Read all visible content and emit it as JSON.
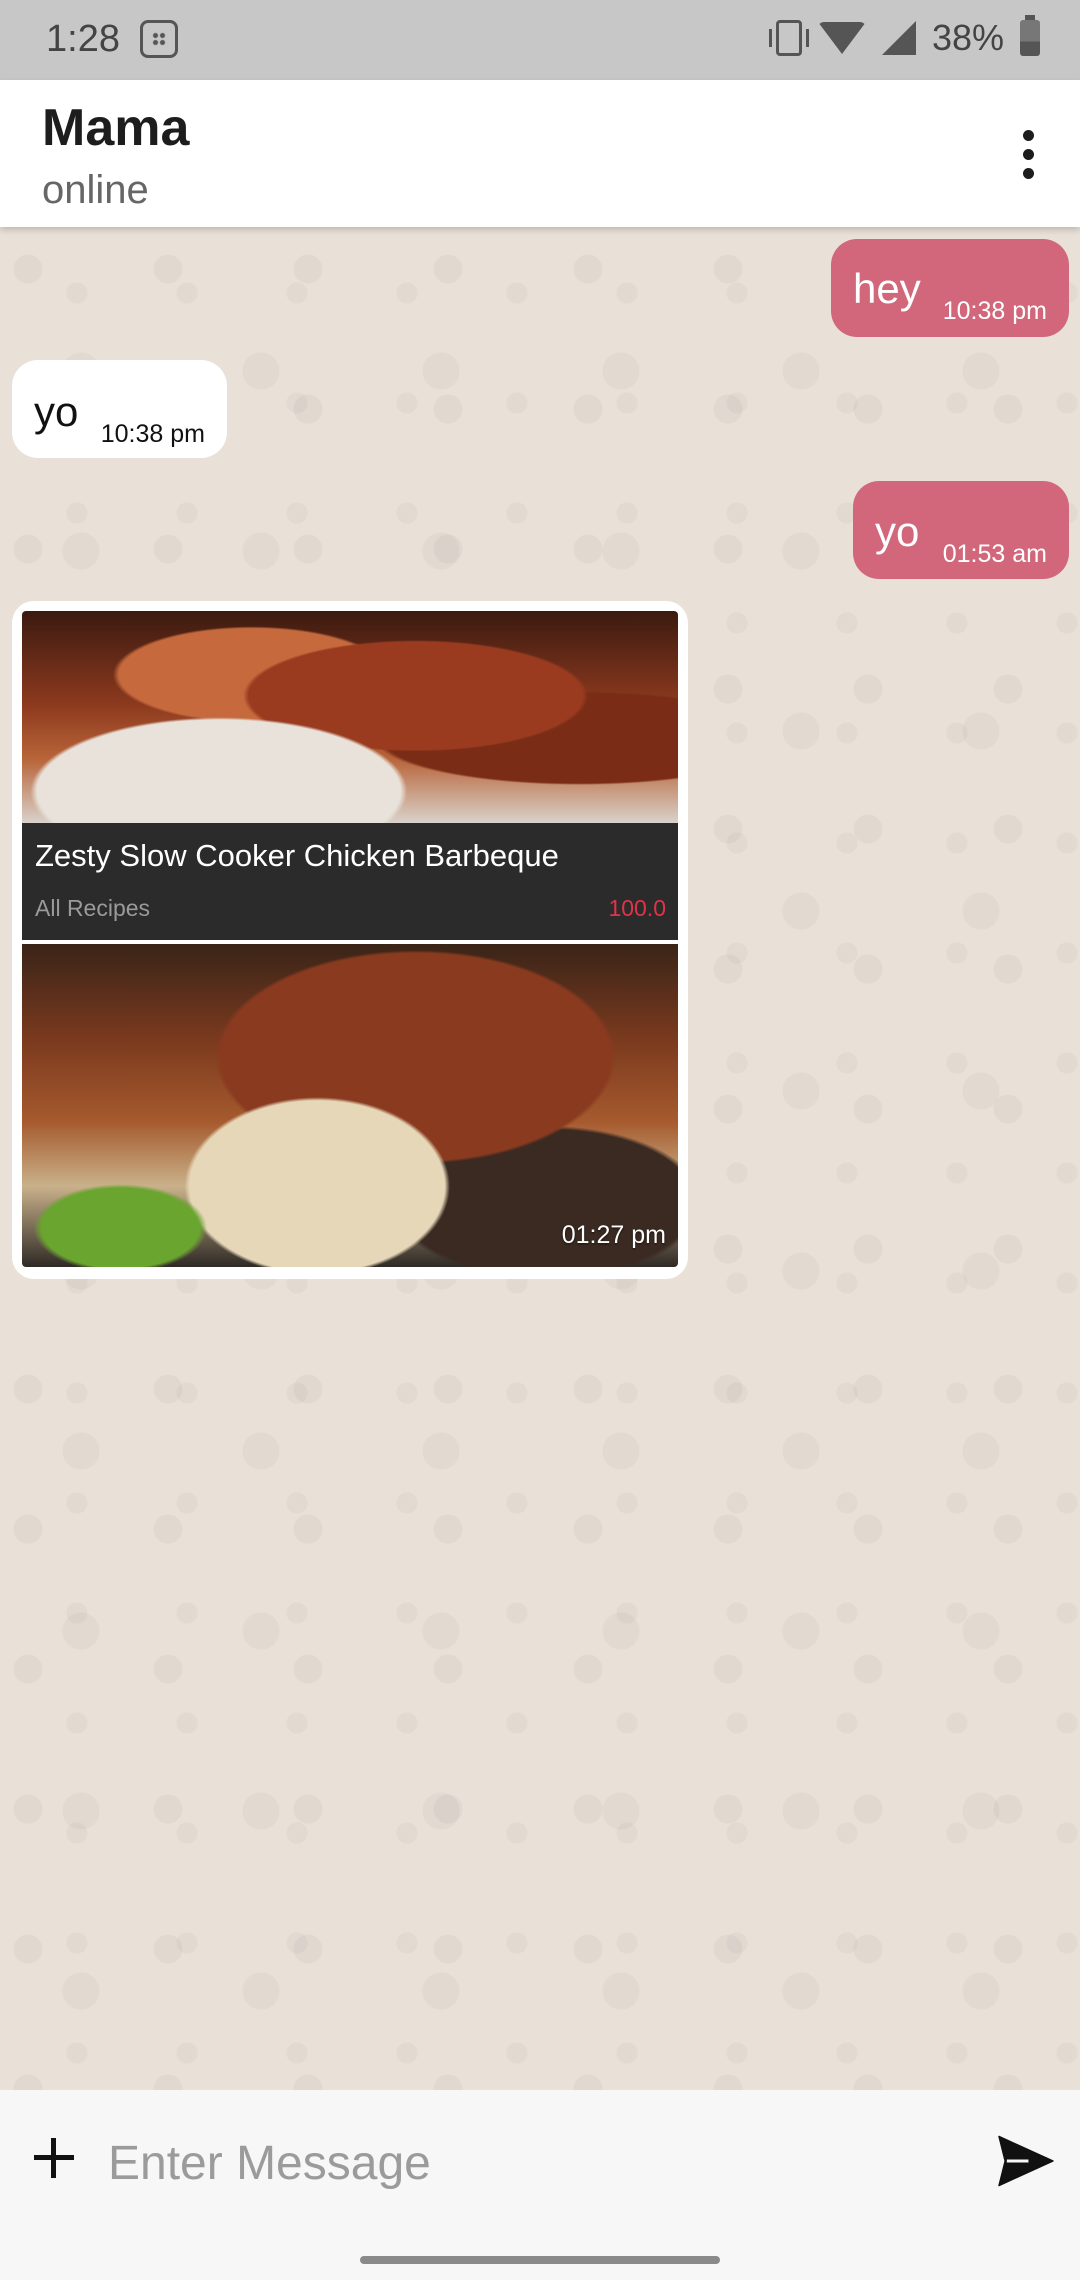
{
  "status_bar": {
    "time": "1:28",
    "battery": "38%"
  },
  "header": {
    "contact_name": "Mama",
    "contact_status": "online",
    "menu_icon": "more-vert-icon"
  },
  "messages": [
    {
      "direction": "outgoing",
      "text": "hey",
      "time": "10:38 pm"
    },
    {
      "direction": "incoming",
      "text": "yo",
      "time": "10:38 pm"
    },
    {
      "direction": "outgoing",
      "text": "yo",
      "time": "01:53 am"
    }
  ],
  "recipe_card": {
    "direction": "incoming",
    "title": "Zesty Slow Cooker Chicken Barbeque",
    "category": "All Recipes",
    "rating": "100.0",
    "time": "01:27 pm"
  },
  "input": {
    "placeholder": "Enter Message",
    "value": ""
  },
  "colors": {
    "outgoing_bubble": "#d2677c",
    "incoming_bubble": "#ffffff",
    "chat_background": "#e9e1d8",
    "rating": "#e0334a"
  }
}
